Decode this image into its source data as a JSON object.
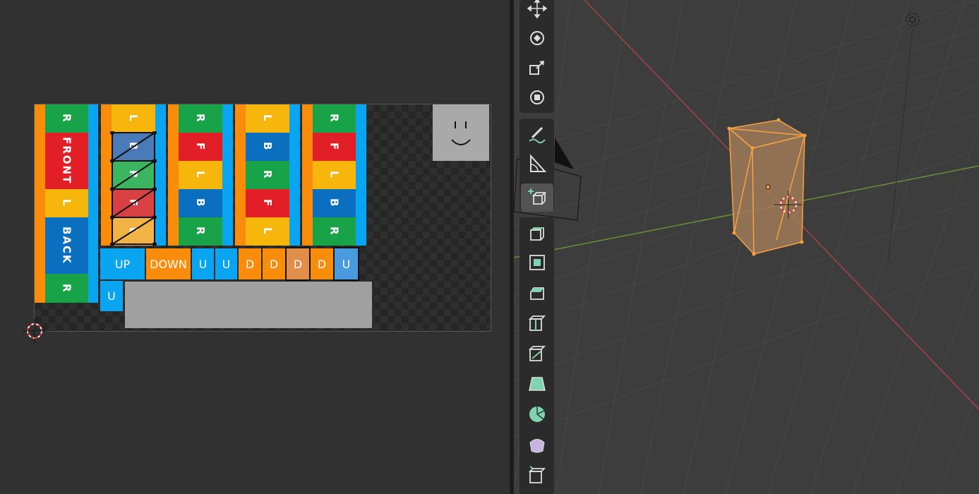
{
  "uv_editor": {
    "strips": [
      {
        "labels": [
          "R",
          "FRONT",
          "L",
          "BACK",
          "R"
        ]
      },
      {
        "labels": [
          "L",
          "B",
          "R",
          "F",
          "L"
        ]
      },
      {
        "labels": [
          "R",
          "F",
          "L",
          "B",
          "R"
        ]
      },
      {
        "labels": [
          "L",
          "B",
          "R",
          "F",
          "L"
        ]
      },
      {
        "labels": [
          "R",
          "F",
          "L",
          "B",
          "R"
        ]
      }
    ],
    "bottom_row": [
      "UP",
      "DOWN",
      "U",
      "U",
      "D",
      "D",
      "D",
      "D",
      "U"
    ],
    "bottom_row2": [
      "U"
    ]
  },
  "toolbar": {
    "tools": [
      {
        "name": "move-icon"
      },
      {
        "name": "rotate-icon"
      },
      {
        "name": "scale-icon"
      },
      {
        "name": "transform-icon"
      },
      {
        "name": "annotate-icon"
      },
      {
        "name": "measure-icon"
      },
      {
        "name": "add-cube-icon"
      },
      {
        "name": "extrude-region-icon"
      },
      {
        "name": "inset-faces-icon"
      },
      {
        "name": "bevel-icon"
      },
      {
        "name": "loop-cut-icon"
      },
      {
        "name": "knife-icon"
      },
      {
        "name": "poly-build-icon"
      },
      {
        "name": "spin-icon"
      },
      {
        "name": "smooth-icon"
      },
      {
        "name": "edge-slide-icon"
      }
    ]
  },
  "colors": {
    "green": "#18a348",
    "red": "#e21e26",
    "yellow": "#f6b60b",
    "blue": "#0a6fbf",
    "light_blue": "#0aa5f0",
    "orange": "#f98c0b",
    "selection": "#f5a142"
  }
}
